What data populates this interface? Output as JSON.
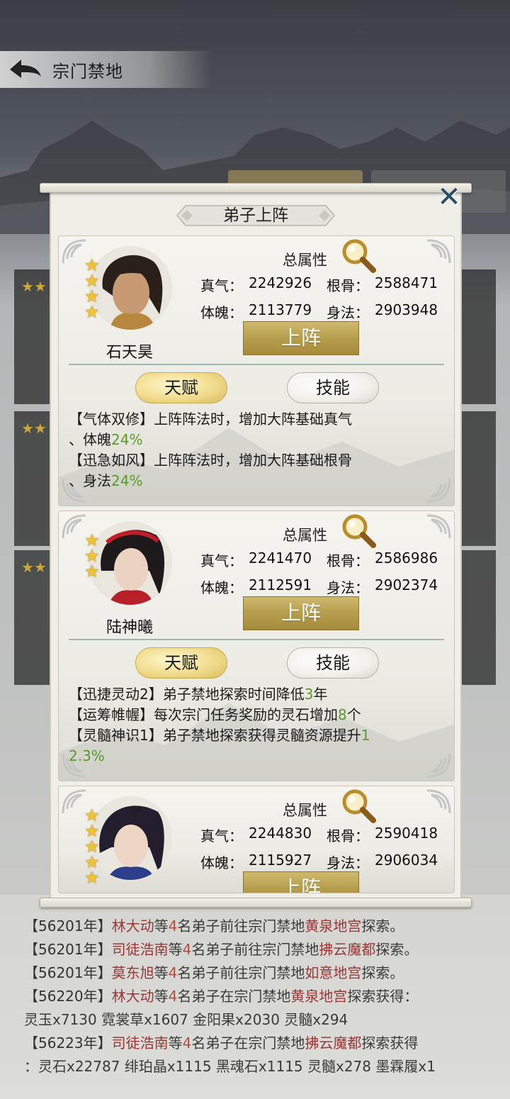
{
  "header": {
    "title": "宗门禁地"
  },
  "popup": {
    "title": "弟子上阵",
    "close_label": "✕",
    "total_attr_label": "总属性",
    "deploy_label": "上阵",
    "talent_tab": "天赋",
    "skill_tab": "技能",
    "stat_labels": {
      "qi": "真气：",
      "bone": "根骨：",
      "body": "体魄：",
      "agility": "身法："
    },
    "disciples": [
      {
        "name": "石天昊",
        "stars": 4,
        "qi": "2242926",
        "bone": "2588471",
        "body": "2113779",
        "agility": "2903948",
        "talents": [
          {
            "line1": "【气体双修】上阵阵法时，增加大阵基础真气",
            "line2_pre": "、体魄",
            "value": "24%"
          },
          {
            "line1": "【迅急如风】上阵阵法时，增加大阵基础根骨",
            "line2_pre": "、身法",
            "value": "24%"
          }
        ]
      },
      {
        "name": "陆神曦",
        "stars": 3,
        "qi": "2241470",
        "bone": "2586986",
        "body": "2112591",
        "agility": "2902374",
        "talents": [
          {
            "pre": "【迅捷灵动2】弟子禁地探索时间降低",
            "value": "3",
            "post": "年"
          },
          {
            "pre": "【运筹帷幄】每次宗门任务奖励的灵石增加",
            "value": "8",
            "post": "个"
          },
          {
            "pre": "【灵髓神识1】弟子禁地探索获得灵髓资源提升",
            "value_a": "1",
            "value_b": "2.3%"
          }
        ]
      },
      {
        "name": "",
        "stars": 5,
        "qi": "2244830",
        "bone": "2590418",
        "body": "2115927",
        "agility": "2906034"
      }
    ]
  },
  "log": {
    "lines": [
      {
        "year": "【56201年】",
        "name": "林大动",
        "mid": "等",
        "num": "4",
        "mid2": "名弟子前往宗门禁地",
        "place": "黄泉地宫",
        "end": "探索。"
      },
      {
        "year": "【56201年】",
        "name": "司徒浩南",
        "mid": "等",
        "num": "4",
        "mid2": "名弟子前往宗门禁地",
        "place": "拂云魔都",
        "end": "探索。"
      },
      {
        "year": "【56201年】",
        "name": "莫东旭",
        "mid": "等",
        "num": "4",
        "mid2": "名弟子前往宗门禁地",
        "place": "如意地宫",
        "end": "探索。"
      },
      {
        "year": "【56220年】",
        "name": "林大动",
        "mid": "等",
        "num": "4",
        "mid2": "名弟子在宗门禁地",
        "place": "黄泉地宫",
        "end": "探索获得："
      },
      {
        "plain": "灵玉x7130 霓裳草x1607 金阳果x2030 灵髓x294"
      },
      {
        "year": "【56223年】",
        "name": "司徒浩南",
        "mid": "等",
        "num": "4",
        "mid2": "名弟子在宗门禁地",
        "place": "拂云魔都",
        "end": "探索获得"
      },
      {
        "plain": "：灵石x22787 绯珀晶x1115 黑魂石x1115 灵髓x278 墨霖履x1"
      }
    ]
  }
}
